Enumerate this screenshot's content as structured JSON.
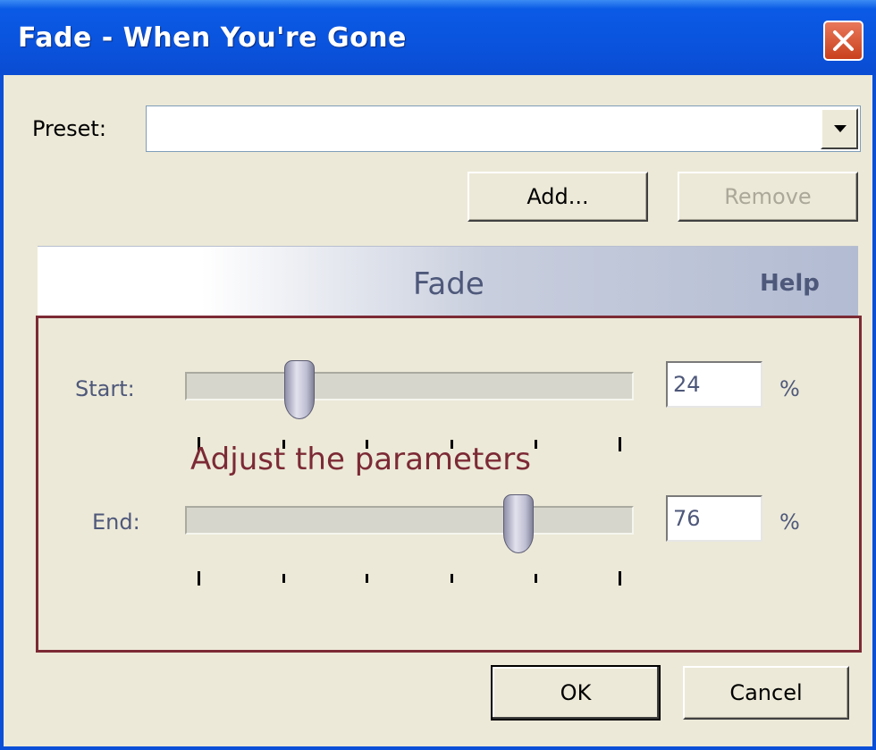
{
  "window": {
    "title": "Fade - When You're Gone",
    "close_icon": "close-icon"
  },
  "preset": {
    "label": "Preset:",
    "value": "",
    "dropdown_icon": "chevron-down-icon"
  },
  "buttons": {
    "add": "Add...",
    "remove": "Remove",
    "ok": "OK",
    "cancel": "Cancel"
  },
  "effect": {
    "title": "Fade",
    "help": "Help"
  },
  "params": {
    "start": {
      "label": "Start:",
      "value": "24",
      "unit": "%",
      "level": 0.24
    },
    "end": {
      "label": "End:",
      "value": "76",
      "unit": "%",
      "level": 0.76
    }
  },
  "annotation": "Adjust the parameters",
  "colors": {
    "accent": "#7c2a35",
    "title_bar": "#0a54de",
    "param_text": "#4e587a"
  }
}
